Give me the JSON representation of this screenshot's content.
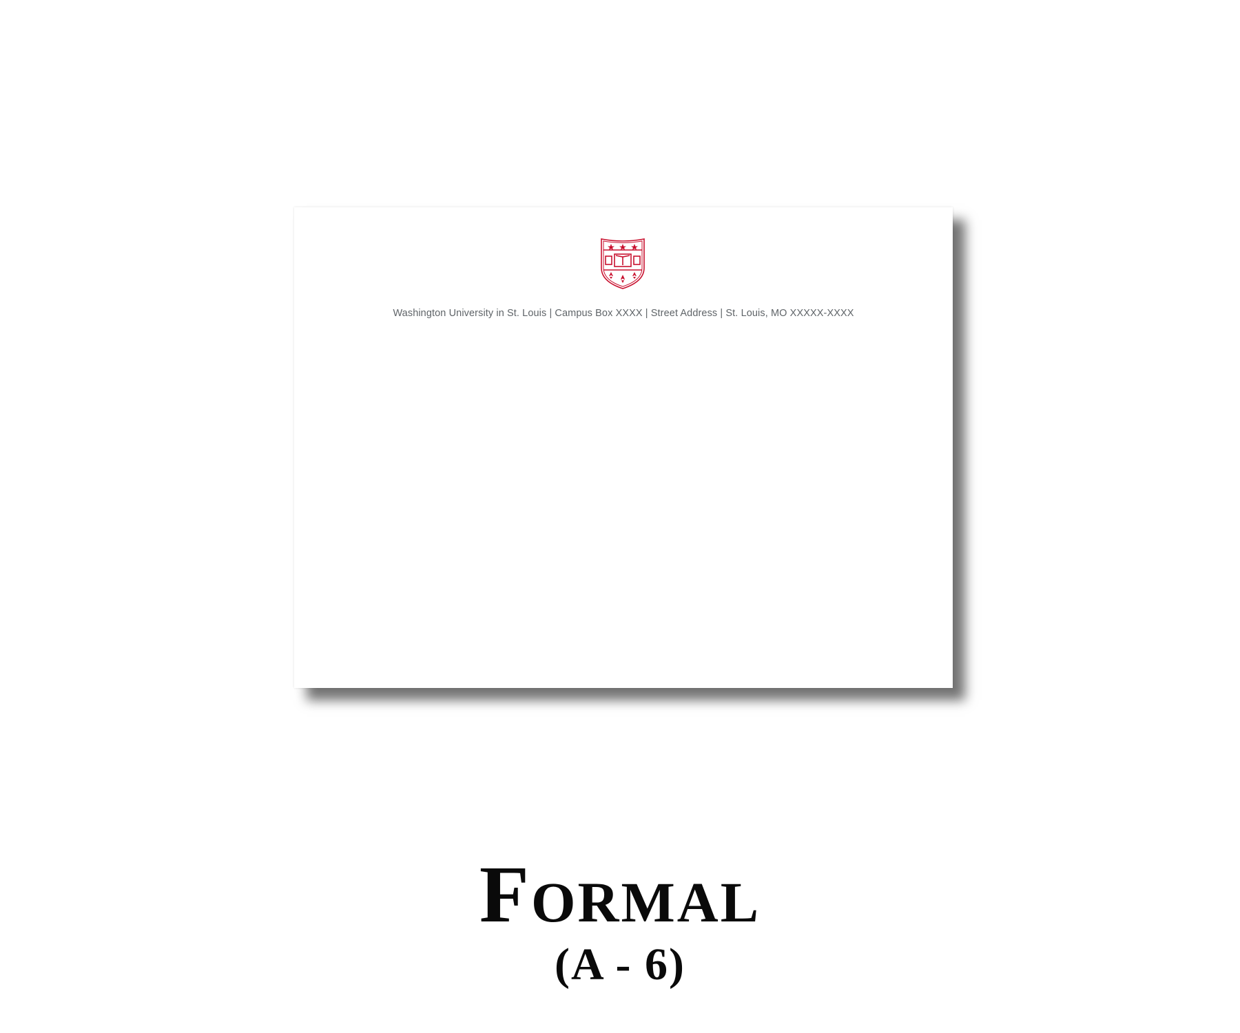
{
  "card": {
    "logo": "wustl-shield-crest",
    "accent_color": "#c8102e",
    "address_line": "Washington University in St. Louis | Campus Box XXXX | Street Address | St. Louis, MO XXXXX-XXXX"
  },
  "caption": {
    "title": "Formal",
    "subtitle": "(A - 6)"
  }
}
